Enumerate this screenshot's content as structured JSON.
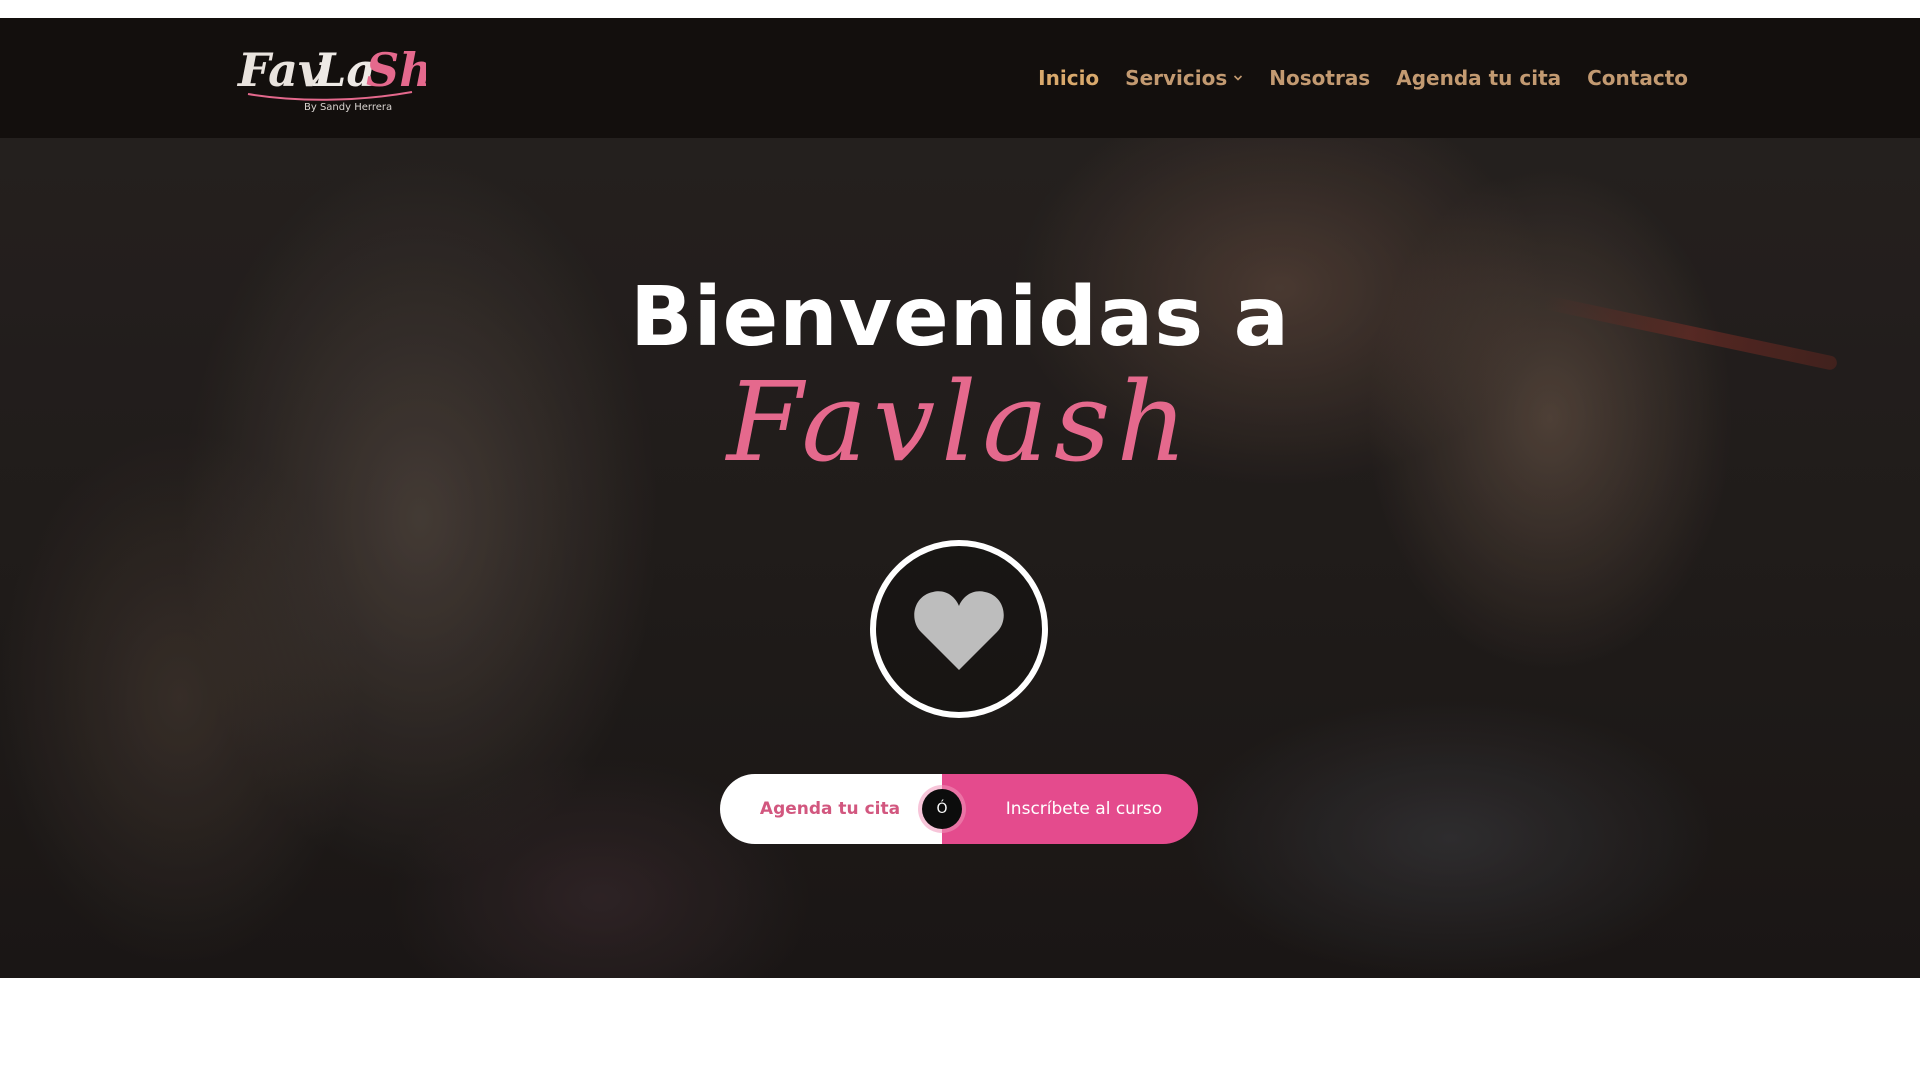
{
  "colors": {
    "header_bg": "#130f0d",
    "nav_text": "#c39a71",
    "brand_pink": "#e5698d",
    "cta_pink": "#e44b8d",
    "cta_left_text": "#d2577f"
  },
  "header": {
    "logo": {
      "wordmark": "FavLaSh",
      "tagline": "By Sandy Herrera"
    },
    "nav": [
      {
        "label": "Inicio",
        "active": true
      },
      {
        "label": "Servicios",
        "has_dropdown": true,
        "icon": "chevron-down-icon"
      },
      {
        "label": "Nosotras"
      },
      {
        "label": "Agenda tu cita"
      },
      {
        "label": "Contacto"
      }
    ]
  },
  "hero": {
    "title": "Bienvenidas a",
    "brand": "Favlash",
    "badge_icon": "heart-icon",
    "cta": {
      "primary_label": "Agenda tu cita",
      "separator": "Ó",
      "secondary_label": "Inscríbete al curso"
    }
  }
}
